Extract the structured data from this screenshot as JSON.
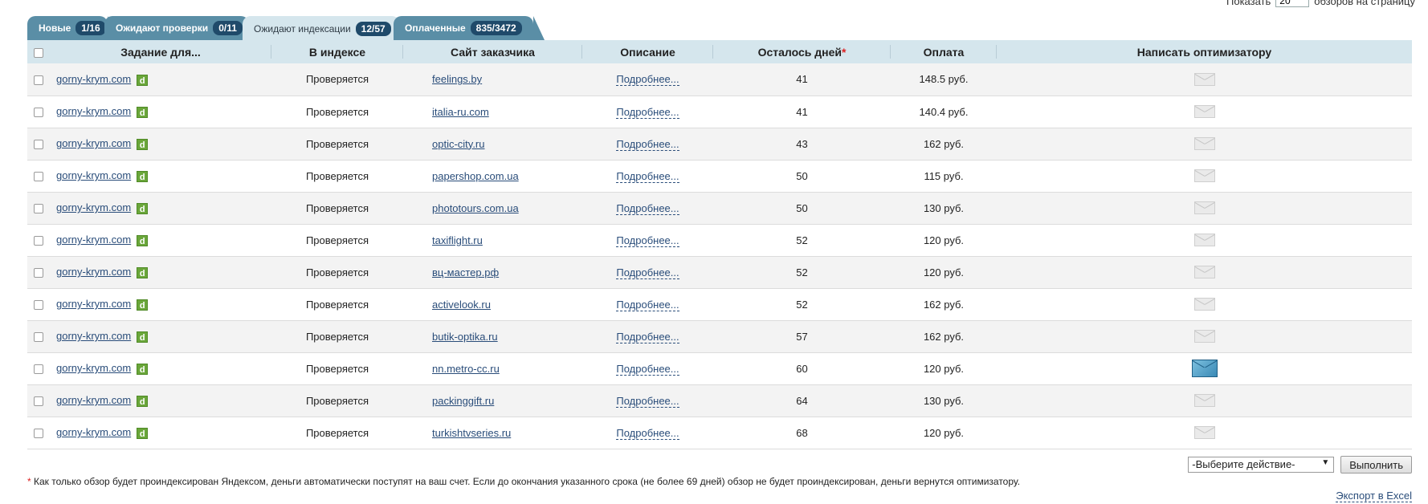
{
  "perpage": {
    "prefix": "Показать",
    "value": "20",
    "suffix": "обзоров на страницу"
  },
  "tabs": [
    {
      "label": "Новые",
      "count": "1/16"
    },
    {
      "label": "Ожидают проверки",
      "count": "0/11"
    },
    {
      "label": "Ожидают индексации",
      "count": "12/57"
    },
    {
      "label": "Оплаченные",
      "count": "835/3472"
    }
  ],
  "active_tab": 2,
  "table": {
    "headers": {
      "task": "Задание для...",
      "index": "В индексе",
      "site": "Сайт заказчика",
      "desc": "Описание",
      "days": "Осталось дней",
      "days_mark": "*",
      "pay": "Оплата",
      "write": "Написать оптимизатору"
    },
    "rows": [
      {
        "task": "gorny-krym.com",
        "badge": "d",
        "index": "Проверяется",
        "site": "feelings.by",
        "desc": "Подробнее...",
        "days": "41",
        "pay": "148.5 руб.",
        "msg_icon": "envelope-icon"
      },
      {
        "task": "gorny-krym.com",
        "badge": "d",
        "index": "Проверяется",
        "site": "italia-ru.com",
        "desc": "Подробнее...",
        "days": "41",
        "pay": "140.4 руб.",
        "msg_icon": "envelope-icon"
      },
      {
        "task": "gorny-krym.com",
        "badge": "d",
        "index": "Проверяется",
        "site": "optic-city.ru",
        "desc": "Подробнее...",
        "days": "43",
        "pay": "162 руб.",
        "msg_icon": "envelope-icon"
      },
      {
        "task": "gorny-krym.com",
        "badge": "d",
        "index": "Проверяется",
        "site": "papershop.com.ua",
        "desc": "Подробнее...",
        "days": "50",
        "pay": "115 руб.",
        "msg_icon": "envelope-icon"
      },
      {
        "task": "gorny-krym.com",
        "badge": "d",
        "index": "Проверяется",
        "site": "phototours.com.ua",
        "desc": "Подробнее...",
        "days": "50",
        "pay": "130 руб.",
        "msg_icon": "envelope-icon"
      },
      {
        "task": "gorny-krym.com",
        "badge": "d",
        "index": "Проверяется",
        "site": "taxiflight.ru",
        "desc": "Подробнее...",
        "days": "52",
        "pay": "120 руб.",
        "msg_icon": "envelope-icon"
      },
      {
        "task": "gorny-krym.com",
        "badge": "d",
        "index": "Проверяется",
        "site": "вц-мастер.рф",
        "desc": "Подробнее...",
        "days": "52",
        "pay": "120 руб.",
        "msg_icon": "envelope-icon"
      },
      {
        "task": "gorny-krym.com",
        "badge": "d",
        "index": "Проверяется",
        "site": "activelook.ru",
        "desc": "Подробнее...",
        "days": "52",
        "pay": "162 руб.",
        "msg_icon": "envelope-icon"
      },
      {
        "task": "gorny-krym.com",
        "badge": "d",
        "index": "Проверяется",
        "site": "butik-optika.ru",
        "desc": "Подробнее...",
        "days": "57",
        "pay": "162 руб.",
        "msg_icon": "envelope-icon"
      },
      {
        "task": "gorny-krym.com",
        "badge": "d",
        "index": "Проверяется",
        "site": "nn.metro-cc.ru",
        "desc": "Подробнее...",
        "days": "60",
        "pay": "120 руб.",
        "msg_icon": "new-messages-envelope-icon"
      },
      {
        "task": "gorny-krym.com",
        "badge": "d",
        "index": "Проверяется",
        "site": "packinggift.ru",
        "desc": "Подробнее...",
        "days": "64",
        "pay": "130 руб.",
        "msg_icon": "envelope-icon"
      },
      {
        "task": "gorny-krym.com",
        "badge": "d",
        "index": "Проверяется",
        "site": "turkishtvseries.ru",
        "desc": "Подробнее...",
        "days": "68",
        "pay": "120 руб.",
        "msg_icon": "envelope-icon"
      }
    ]
  },
  "actions": {
    "select_value": "-Выберите действие-",
    "run": "Выполнить"
  },
  "note": {
    "star": "*",
    "text": "Как только обзор будет проиндексирован Яндексом, деньги автоматически поступят на ваш счет. Если до окончания указанного срока (не более 69 дней) обзор не будет проиндексирован, деньги вернутся оптимизатору."
  },
  "export": "Экспорт в Excel"
}
